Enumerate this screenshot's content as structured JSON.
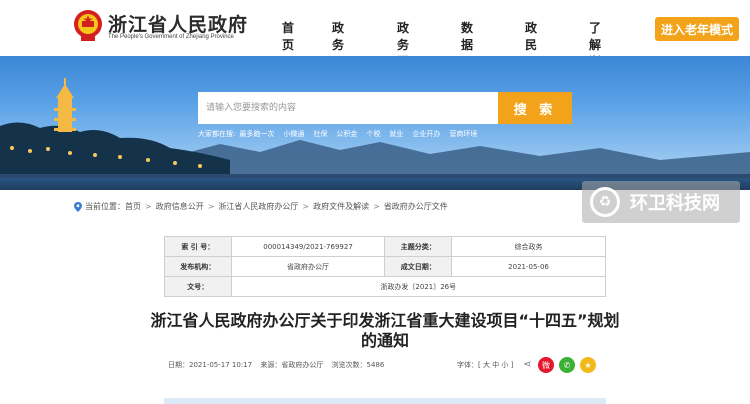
{
  "header": {
    "site_title": "浙江省人民政府",
    "site_subtitle": "The People's Government of Zhejiang Province",
    "nav": [
      "首页",
      "政务公开",
      "政务服务",
      "数据开放",
      "政民互动",
      "了解浙江"
    ],
    "elder_mode": "进入老年模式"
  },
  "banner": {
    "search_placeholder": "请输入您要搜索的内容",
    "search_button": "搜 索",
    "hot_label": "大家都在搜:",
    "hot_items": [
      "最多跑一次",
      "小微通",
      "社保",
      "公积金",
      "个税",
      "就业",
      "企业开办",
      "营商环境"
    ]
  },
  "breadcrumb": {
    "label": "当前位置：",
    "items": [
      "首页",
      "政府信息公开",
      "浙江省人民政府办公厅",
      "政府文件及解读",
      "省政府办公厅文件"
    ]
  },
  "watermark": {
    "text": "环卫科技网",
    "icon": "recycle-icon"
  },
  "info": {
    "index_key": "索 引 号：",
    "index_val": "000014349/2021-769927",
    "topic_key": "主题分类：",
    "topic_val": "综合政务",
    "org_key": "发布机构：",
    "org_val": "省政府办公厅",
    "date_key": "成文日期：",
    "date_val": "2021-05-06",
    "doc_key": "文号：",
    "doc_val": "浙政办发〔2021〕26号"
  },
  "article": {
    "title_line1": "浙江省人民政府办公厅关于印发浙江省重大建设项目“十四五”规划",
    "title_line2": "的通知",
    "date": "日期：2021-05-17 10:17",
    "source": "来源：省政府办公厅",
    "views": "浏览次数：5486",
    "font_ctl": "字体：[ 大 中 小 ]"
  },
  "colors": {
    "accent": "#f3a319",
    "weibo": "#e6162d",
    "wechat": "#3cb035"
  }
}
